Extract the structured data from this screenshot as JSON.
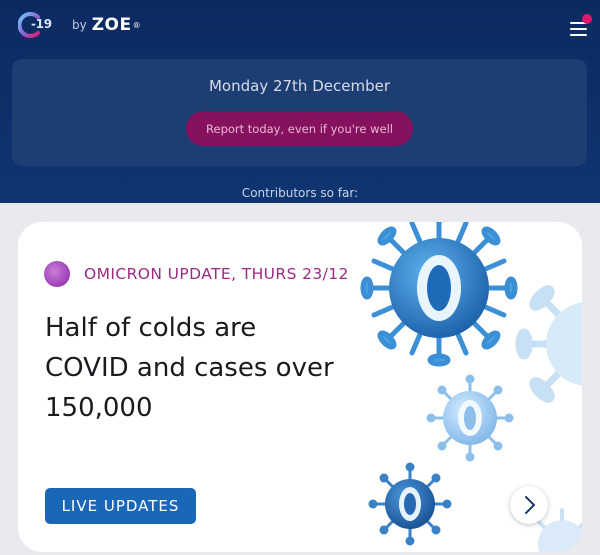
{
  "header": {
    "logo": {
      "number": "-19",
      "by": "by",
      "brand": "ZOE",
      "reg": "®"
    },
    "menu_icon": "hamburger-menu-icon",
    "notification_color": "#e0186c"
  },
  "date_card": {
    "date": "Monday 27th December",
    "report_button": "Report today, even if you're well"
  },
  "contributors": {
    "label": "Contributors so far:"
  },
  "news_card": {
    "tag": "OMICRON UPDATE, THURS 23/12",
    "headline": "Half of colds are COVID and cases over 150,000",
    "button": "LIVE UPDATES",
    "next_icon": "chevron-right-icon",
    "art": "omicron-virus-illustration"
  },
  "colors": {
    "header_bg": "#0f3571",
    "card_bg": "#1c3e72",
    "report_button": "#86115f",
    "tag_text": "#9a2a83",
    "live_button": "#1a66b7"
  }
}
